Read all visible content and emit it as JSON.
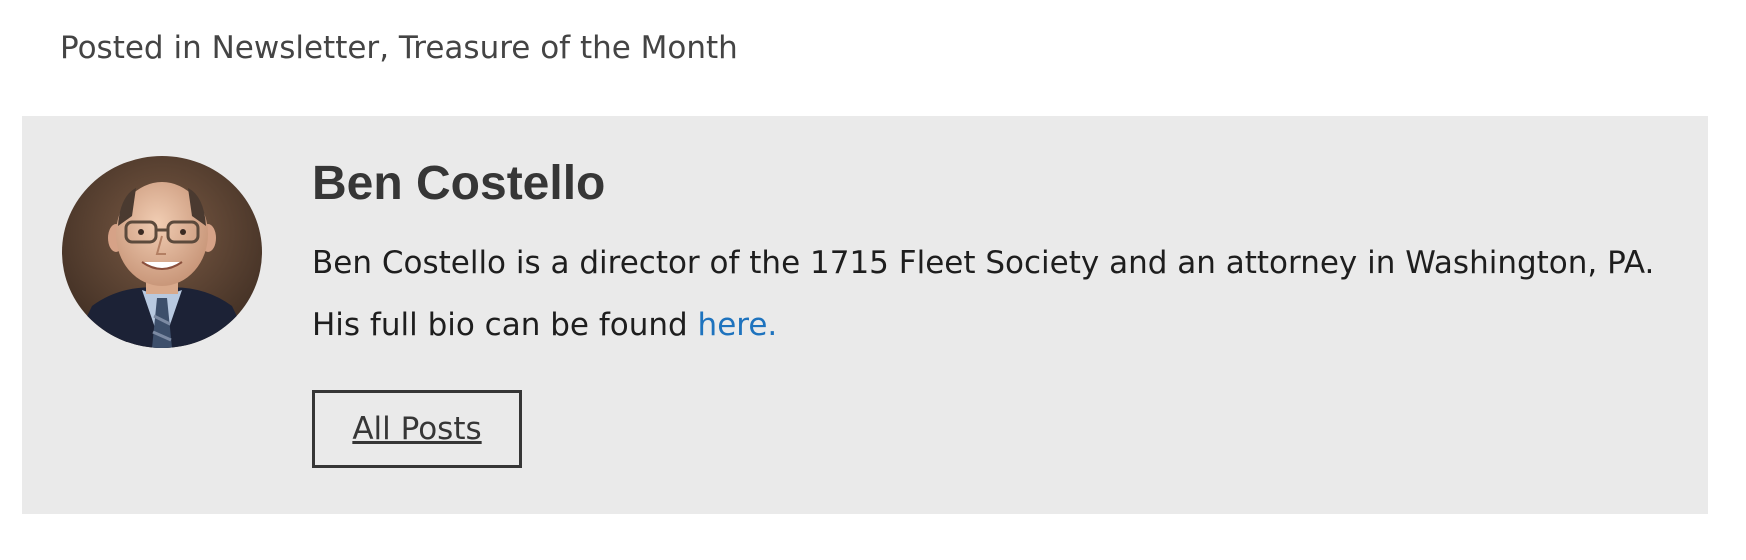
{
  "post_meta": {
    "prefix": "Posted in ",
    "categories": [
      "Newsletter",
      "Treasure of the Month"
    ],
    "separator": ", "
  },
  "author_box": {
    "avatar_icon": "author-avatar-photo",
    "name": "Ben Costello",
    "bio_text": "Ben Costello is a director of the 1715 Fleet Society and an attorney in Washington, PA. His full bio can be found ",
    "bio_link_label": "here.",
    "all_posts_label": "All Posts",
    "colors": {
      "box_background": "#eaeaea",
      "link": "#1e73be",
      "text_dark": "#363636"
    }
  }
}
